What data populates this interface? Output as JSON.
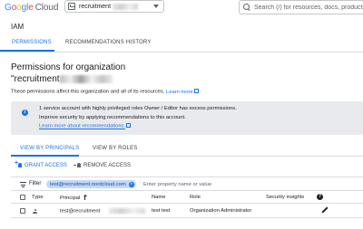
{
  "header": {
    "logo_letters": [
      "G",
      "o",
      "o",
      "g",
      "l",
      "e"
    ],
    "logo_cloud": "Cloud",
    "project_name": "recruitment",
    "search_placeholder": "Search (/) for resources, docs, products, and more"
  },
  "page": {
    "title": "IAM",
    "tabs": [
      {
        "label": "PERMISSIONS",
        "active": true
      },
      {
        "label": "RECOMMENDATIONS HISTORY",
        "active": false
      }
    ],
    "permissions_title": "Permissions for organization",
    "org_name_prefix": "\"recruitment",
    "description": "These permissions affect this organization and all of its resources.",
    "learn_more": "Learn more"
  },
  "banner": {
    "icon": "info-icon",
    "line1": "1 service account with highly privileged roles Owner / Editor has excess permissions.",
    "line2": "Improve security by applying recommendations to this account.",
    "link": "Learn more about recommendations."
  },
  "view_tabs": [
    {
      "label": "VIEW BY PRINCIPALS",
      "active": true
    },
    {
      "label": "VIEW BY ROLES",
      "active": false
    }
  ],
  "actions": {
    "grant": "GRANT ACCESS",
    "remove": "REMOVE ACCESS"
  },
  "filter": {
    "label": "Filter",
    "chip": "test@recruitment.nordcloud.com",
    "placeholder": "Enter property name or value"
  },
  "table": {
    "columns": [
      "Type",
      "Principal",
      "Name",
      "Role",
      "Security insights"
    ],
    "rows": [
      {
        "type_icon": "person-icon",
        "principal": "test@recruitment",
        "name": "test test",
        "role": "Organization Administrator"
      }
    ]
  },
  "colors": {
    "accent": "#1a73e8",
    "banner_bg": "#e8eaed",
    "chip_bg": "#c2d8fb"
  }
}
